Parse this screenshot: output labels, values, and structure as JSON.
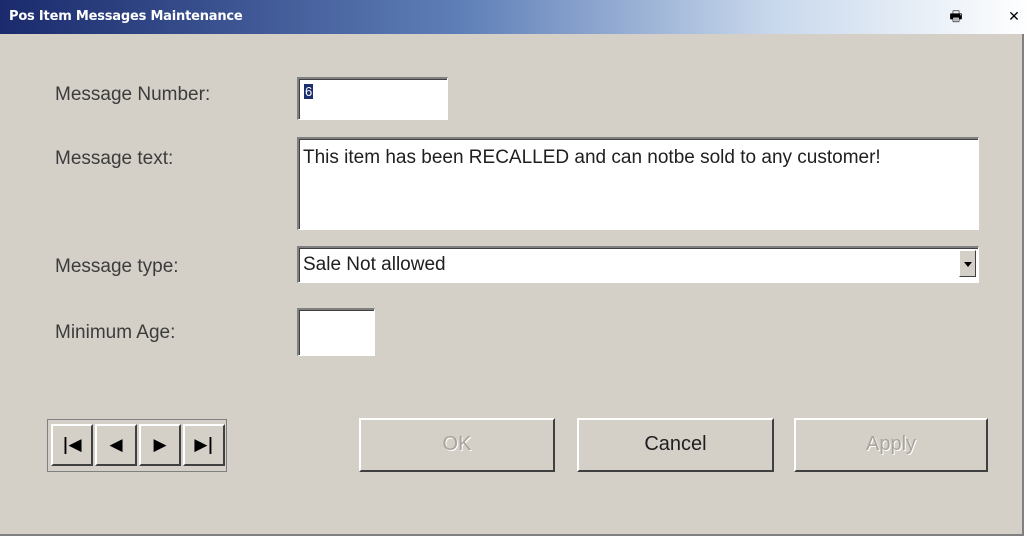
{
  "window": {
    "title": "Pos Item Messages Maintenance",
    "titlebar_icons": [
      "print-icon",
      "close-icon"
    ],
    "close_glyph": "✕",
    "print_glyph": "🖶"
  },
  "form": {
    "message_number": {
      "label": "Message Number:",
      "value": "6"
    },
    "message_text": {
      "label": "Message text:",
      "value": "This item has been  RECALLED and can notbe sold to any customer!"
    },
    "message_type": {
      "label": "Message type:",
      "value": "Sale Not allowed"
    },
    "minimum_age": {
      "label": "Minimum Age:",
      "value": ""
    }
  },
  "navigation": {
    "first": "|◀",
    "prev": "◀",
    "next": "▶",
    "last": "▶|"
  },
  "buttons": {
    "ok": "OK",
    "cancel": "Cancel",
    "apply": "Apply"
  },
  "colors": {
    "title_bar_start": "#1a2a6c",
    "dialog_background": "#d4d0c8"
  }
}
